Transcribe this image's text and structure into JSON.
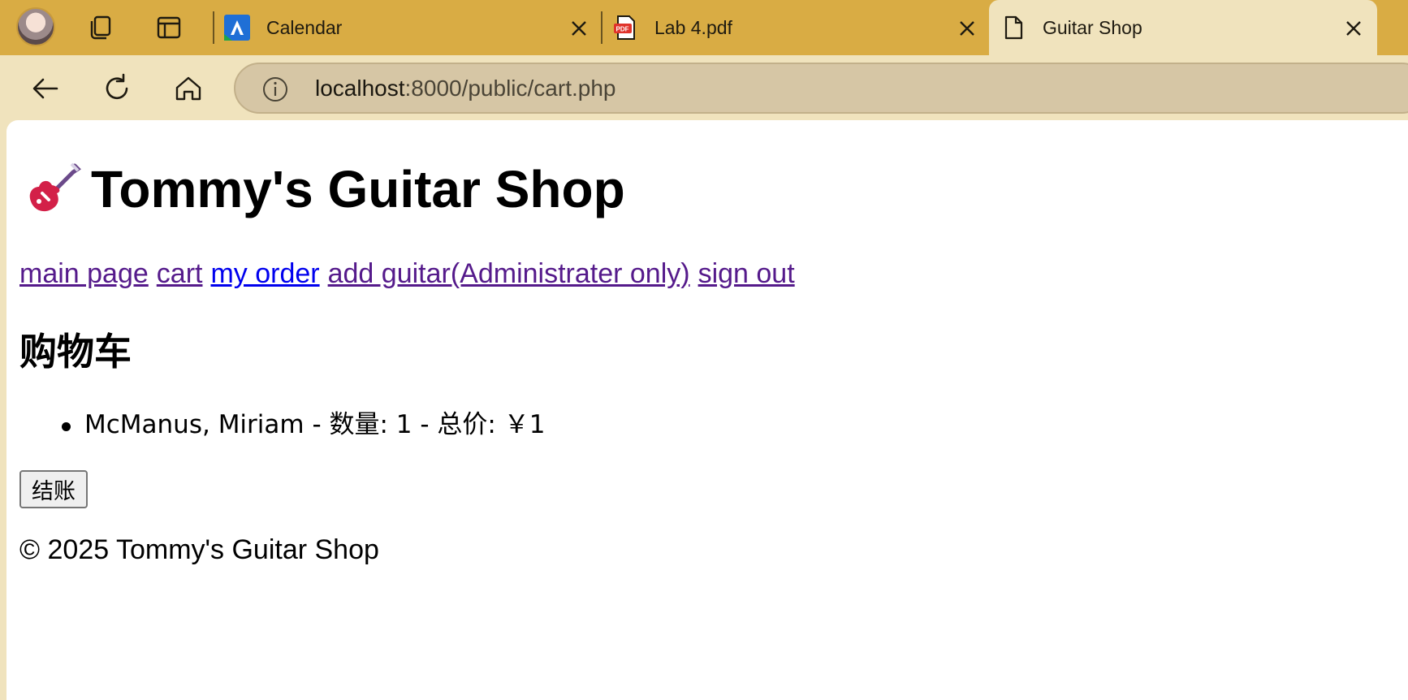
{
  "browser": {
    "tabs": [
      {
        "title": "Calendar",
        "favicon": "calendar-app-icon",
        "active": false
      },
      {
        "title": "Lab 4.pdf",
        "favicon": "pdf-icon",
        "active": false
      },
      {
        "title": "Guitar Shop",
        "favicon": "page-icon",
        "active": true
      }
    ],
    "url": {
      "host": "localhost",
      "path": ":8000/public/cart.php"
    },
    "colors": {
      "frame": "#d9ac44",
      "active_tab": "#f0e3bd",
      "omnibox": "#d6c6a5"
    }
  },
  "page": {
    "site_title": "Tommy's Guitar Shop",
    "site_icon": "guitar-icon",
    "nav": [
      {
        "label": "main page",
        "visited": true
      },
      {
        "label": "cart",
        "visited": true
      },
      {
        "label": "my order",
        "visited": false
      },
      {
        "label": "add guitar(Administrater only)",
        "visited": true
      },
      {
        "label": "sign out",
        "visited": true
      }
    ],
    "cart_heading": "购物车",
    "cart_items": [
      {
        "text": "McManus, Miriam - 数量: 1 - 总价: ￥1"
      }
    ],
    "checkout_label": "结账",
    "footer": "© 2025 Tommy's Guitar Shop"
  }
}
